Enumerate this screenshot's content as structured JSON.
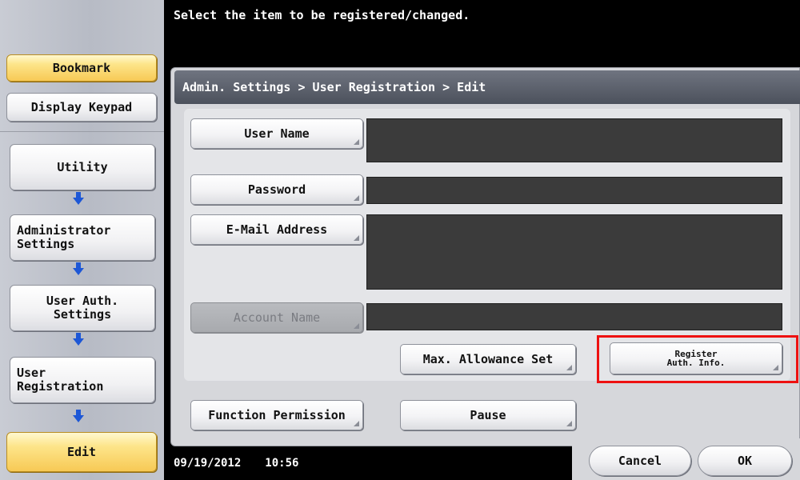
{
  "header": {
    "instruction": "Select the item to be registered/changed."
  },
  "sidebar": {
    "bookmark": "Bookmark",
    "display_keypad": "Display Keypad",
    "path": [
      {
        "label": "Utility"
      },
      {
        "label": "Administrator Settings"
      },
      {
        "label": "User Auth. Settings"
      },
      {
        "label": "User Registration"
      },
      {
        "label": "Edit"
      }
    ],
    "arrow_icon": "arrow-down-icon",
    "arrow_color": "#1d57d6"
  },
  "breadcrumb": "Admin. Settings > User Registration > Edit",
  "form": {
    "user_name": {
      "label": "User Name",
      "value": ""
    },
    "password": {
      "label": "Password",
      "value": ""
    },
    "email": {
      "label": "E-Mail Address",
      "value": ""
    },
    "account_name": {
      "label": "Account Name",
      "value": "",
      "disabled": true
    },
    "max_allowance": "Max. Allowance Set",
    "register_auth": {
      "line1": "Register",
      "line2": "Auth. Info."
    },
    "function_permission": "Function Permission",
    "pause": "Pause"
  },
  "status": {
    "date": "09/19/2012",
    "time": "10:56"
  },
  "actions": {
    "cancel": "Cancel",
    "ok": "OK"
  },
  "colors": {
    "highlight_box": "#ee1111",
    "gold_button": "#f7c955",
    "field_bg": "#3b3b3b"
  }
}
